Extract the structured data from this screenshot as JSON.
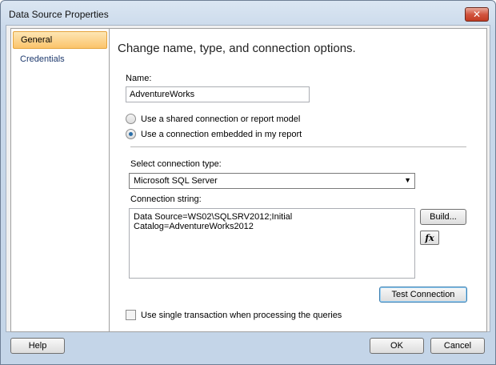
{
  "window": {
    "title": "Data Source Properties",
    "close_label": "✕"
  },
  "nav": {
    "items": [
      {
        "label": "General",
        "selected": true
      },
      {
        "label": "Credentials",
        "selected": false
      }
    ]
  },
  "panel": {
    "heading": "Change name, type, and connection options.",
    "name_label": "Name:",
    "name_value": "AdventureWorks",
    "radio_shared": "Use a shared connection or report model",
    "radio_embedded": "Use a connection embedded in my report",
    "conn_type_label": "Select connection type:",
    "conn_type_value": "Microsoft SQL Server",
    "conn_string_label": "Connection string:",
    "conn_string_value": "Data Source=WS02\\SQLSRV2012;Initial Catalog=AdventureWorks2012",
    "build_button": "Build...",
    "fx_button": "fx",
    "test_button": "Test Connection",
    "checkbox_label": "Use single transaction when processing the queries"
  },
  "footer": {
    "help": "Help",
    "ok": "OK",
    "cancel": "Cancel"
  },
  "icons": {
    "dropdown": "chevron-down-icon",
    "close": "close-icon",
    "expression": "function-icon"
  }
}
